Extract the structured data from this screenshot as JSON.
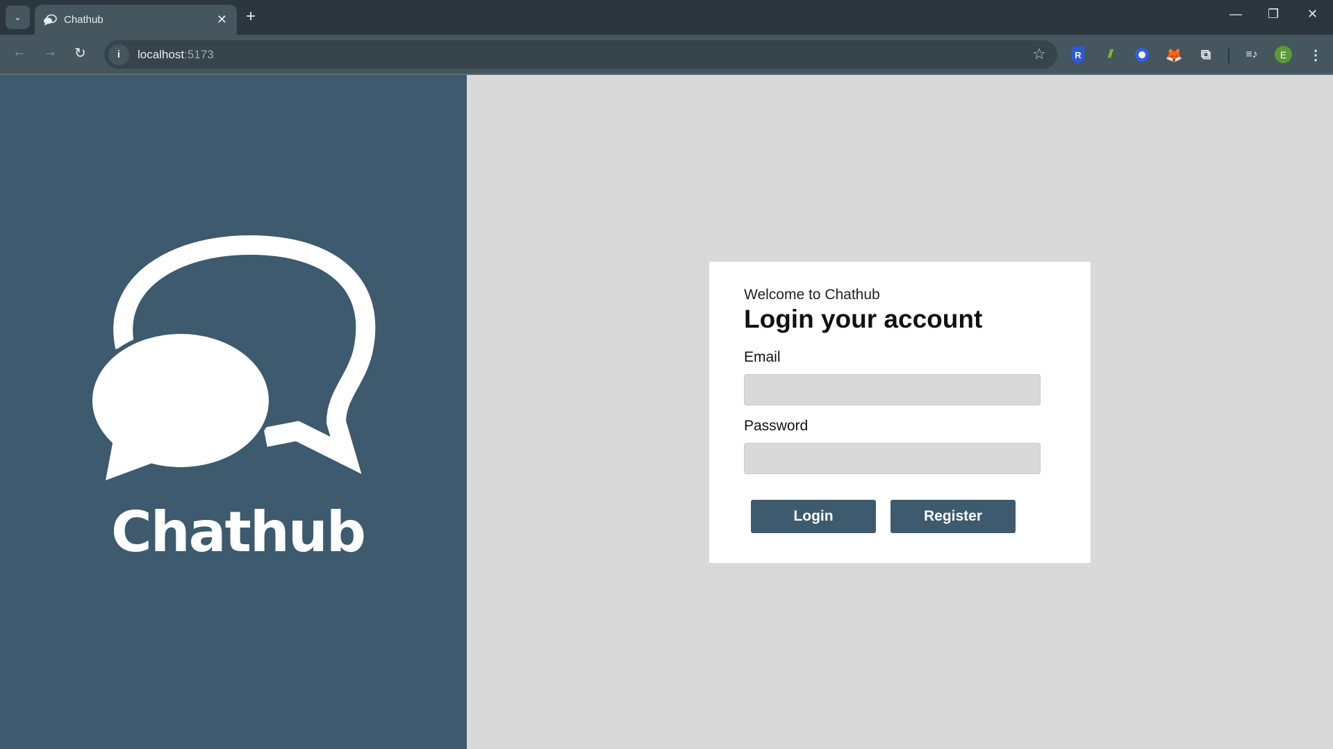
{
  "browser": {
    "tab_title": "Chathub",
    "url_host": "localhost",
    "url_port": ":5173",
    "extensions": [
      "r-shield-icon",
      "chart-extension-icon",
      "circle-extension-icon",
      "metamask-fox-icon",
      "puzzle-extensions-icon",
      "media-control-icon"
    ],
    "profile_initial": "E",
    "profile_color": "#5b9a37"
  },
  "brand": {
    "name": "Chathub",
    "panel_color": "#3d5a6e"
  },
  "login": {
    "welcome": "Welcome to Chathub",
    "title": "Login your account",
    "email_label": "Email",
    "email_value": "",
    "password_label": "Password",
    "password_value": "",
    "login_button": "Login",
    "register_button": "Register"
  }
}
